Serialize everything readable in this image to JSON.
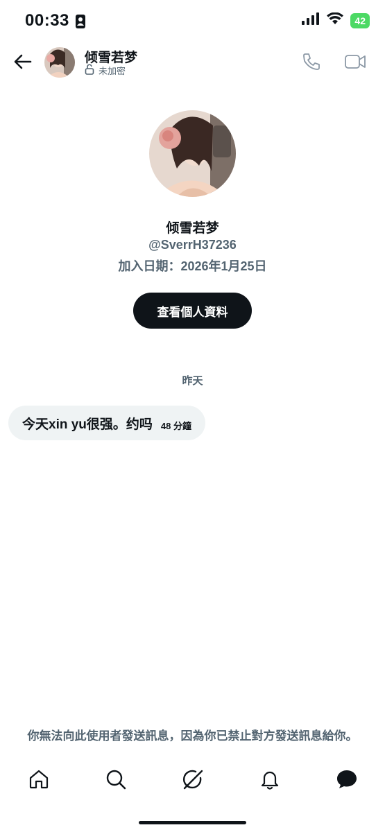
{
  "status_bar": {
    "time": "00:33",
    "battery": "42"
  },
  "header": {
    "name": "倾雪若梦",
    "encryption": "未加密"
  },
  "profile": {
    "name": "倾雪若梦",
    "handle": "@SverrH37236",
    "joined": "加入日期：2026年1月25日",
    "view_profile_label": "查看個人資料"
  },
  "conversation": {
    "date_divider": "昨天",
    "messages": [
      {
        "text": "今天xin yu很强。约吗",
        "time": "48 分鐘"
      }
    ]
  },
  "blocked_notice": "你無法向此使用者發送訊息，因為你已禁止對方發送訊息給你。",
  "nav": {
    "items": [
      "home-icon",
      "search-icon",
      "grok-icon",
      "notifications-icon",
      "messages-icon"
    ]
  },
  "colors": {
    "text": "#0f1419",
    "secondary": "#536471",
    "bubble": "#eff3f4",
    "battery": "#4cd964"
  }
}
